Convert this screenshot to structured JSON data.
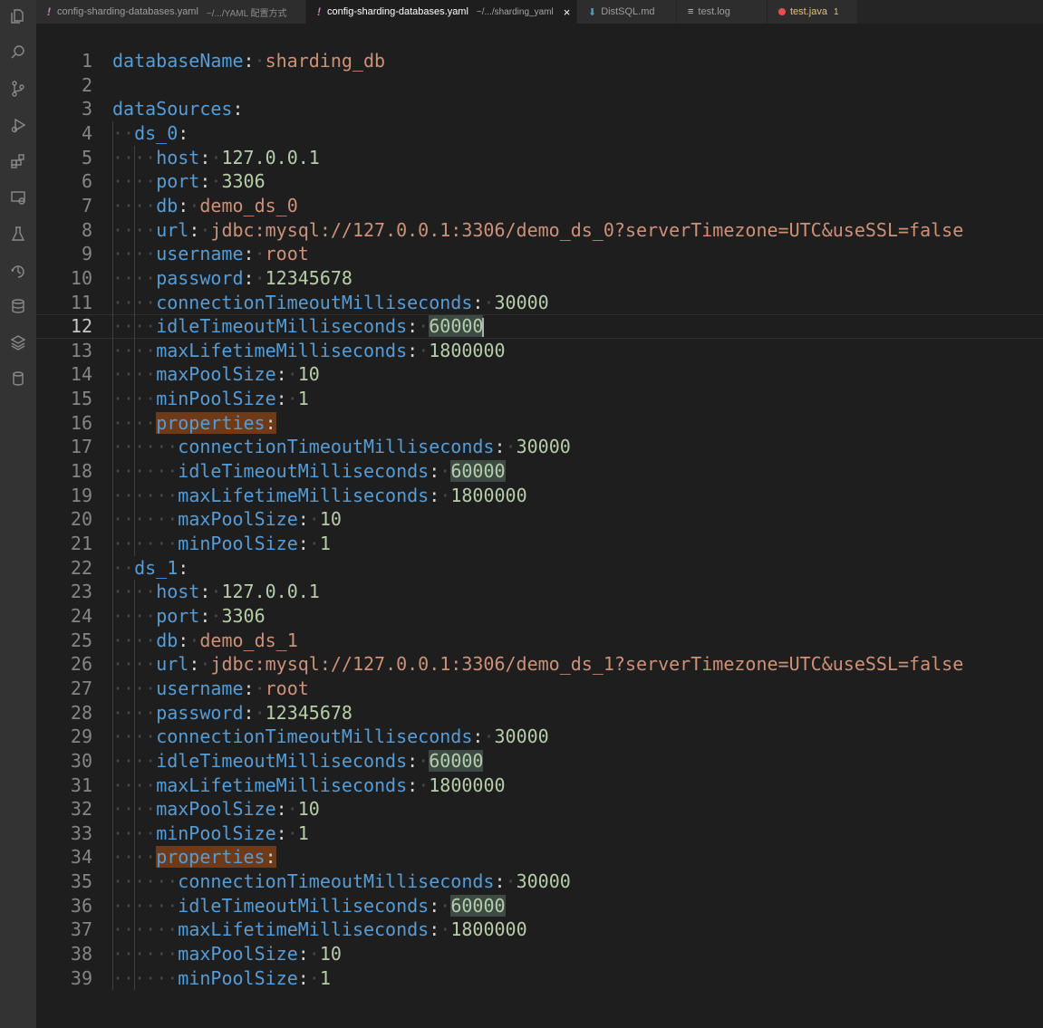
{
  "tabs": [
    {
      "name": "config-sharding-databases.yaml",
      "desc": "~/.../YAML 配置方式",
      "icon": "!",
      "active": false
    },
    {
      "name": "config-sharding-databases.yaml",
      "desc": "~/.../sharding_yaml",
      "icon": "!",
      "active": true,
      "close": "×"
    },
    {
      "name": "DistSQL.md",
      "icon": "⬇",
      "active": false
    },
    {
      "name": "test.log",
      "icon": "≡",
      "active": false
    },
    {
      "name": "test.java",
      "count": "1",
      "active": false
    }
  ],
  "activity_icons": [
    "files-icon",
    "search-icon",
    "source-control-icon",
    "run-debug-icon",
    "extensions-icon",
    "remote-explorer-icon",
    "testing-icon",
    "timeline-icon",
    "database-icon",
    "layers-icon",
    "database-icon-2"
  ],
  "current_line": 12,
  "lines": [
    {
      "n": "1",
      "indent": 0,
      "key": "databaseName",
      "val": "sharding_db",
      "vtype": "s"
    },
    {
      "n": "2",
      "indent": 0
    },
    {
      "n": "3",
      "indent": 0,
      "key": "dataSources"
    },
    {
      "n": "4",
      "indent": 1,
      "key": "ds_0"
    },
    {
      "n": "5",
      "indent": 2,
      "key": "host",
      "val": "127.0.0.1",
      "vtype": "n"
    },
    {
      "n": "6",
      "indent": 2,
      "key": "port",
      "val": "3306",
      "vtype": "n"
    },
    {
      "n": "7",
      "indent": 2,
      "key": "db",
      "val": "demo_ds_0",
      "vtype": "s"
    },
    {
      "n": "8",
      "indent": 2,
      "key": "url",
      "val": "jdbc:mysql://127.0.0.1:3306/demo_ds_0?serverTimezone=UTC&useSSL=false",
      "vtype": "s"
    },
    {
      "n": "9",
      "indent": 2,
      "key": "username",
      "val": "root",
      "vtype": "s"
    },
    {
      "n": "10",
      "indent": 2,
      "key": "password",
      "val": "12345678",
      "vtype": "n"
    },
    {
      "n": "11",
      "indent": 2,
      "key": "connectionTimeoutMilliseconds",
      "val": "30000",
      "vtype": "n"
    },
    {
      "n": "12",
      "indent": 2,
      "key": "idleTimeoutMilliseconds",
      "val": "60000",
      "vtype": "n",
      "hl": true
    },
    {
      "n": "13",
      "indent": 2,
      "key": "maxLifetimeMilliseconds",
      "val": "1800000",
      "vtype": "n"
    },
    {
      "n": "14",
      "indent": 2,
      "key": "maxPoolSize",
      "val": "10",
      "vtype": "n"
    },
    {
      "n": "15",
      "indent": 2,
      "key": "minPoolSize",
      "val": "1",
      "vtype": "n"
    },
    {
      "n": "16",
      "indent": 2,
      "key": "properties",
      "hlk": true
    },
    {
      "n": "17",
      "indent": 3,
      "key": "connectionTimeoutMilliseconds",
      "val": "30000",
      "vtype": "n"
    },
    {
      "n": "18",
      "indent": 3,
      "key": "idleTimeoutMilliseconds",
      "val": "60000",
      "vtype": "n",
      "hl": true
    },
    {
      "n": "19",
      "indent": 3,
      "key": "maxLifetimeMilliseconds",
      "val": "1800000",
      "vtype": "n"
    },
    {
      "n": "20",
      "indent": 3,
      "key": "maxPoolSize",
      "val": "10",
      "vtype": "n"
    },
    {
      "n": "21",
      "indent": 3,
      "key": "minPoolSize",
      "val": "1",
      "vtype": "n"
    },
    {
      "n": "22",
      "indent": 1,
      "key": "ds_1"
    },
    {
      "n": "23",
      "indent": 2,
      "key": "host",
      "val": "127.0.0.1",
      "vtype": "n"
    },
    {
      "n": "24",
      "indent": 2,
      "key": "port",
      "val": "3306",
      "vtype": "n"
    },
    {
      "n": "25",
      "indent": 2,
      "key": "db",
      "val": "demo_ds_1",
      "vtype": "s"
    },
    {
      "n": "26",
      "indent": 2,
      "key": "url",
      "val": "jdbc:mysql://127.0.0.1:3306/demo_ds_1?serverTimezone=UTC&useSSL=false",
      "vtype": "s"
    },
    {
      "n": "27",
      "indent": 2,
      "key": "username",
      "val": "root",
      "vtype": "s"
    },
    {
      "n": "28",
      "indent": 2,
      "key": "password",
      "val": "12345678",
      "vtype": "n"
    },
    {
      "n": "29",
      "indent": 2,
      "key": "connectionTimeoutMilliseconds",
      "val": "30000",
      "vtype": "n"
    },
    {
      "n": "30",
      "indent": 2,
      "key": "idleTimeoutMilliseconds",
      "val": "60000",
      "vtype": "n",
      "hl": true
    },
    {
      "n": "31",
      "indent": 2,
      "key": "maxLifetimeMilliseconds",
      "val": "1800000",
      "vtype": "n"
    },
    {
      "n": "32",
      "indent": 2,
      "key": "maxPoolSize",
      "val": "10",
      "vtype": "n"
    },
    {
      "n": "33",
      "indent": 2,
      "key": "minPoolSize",
      "val": "1",
      "vtype": "n"
    },
    {
      "n": "34",
      "indent": 2,
      "key": "properties",
      "hlk": true
    },
    {
      "n": "35",
      "indent": 3,
      "key": "connectionTimeoutMilliseconds",
      "val": "30000",
      "vtype": "n"
    },
    {
      "n": "36",
      "indent": 3,
      "key": "idleTimeoutMilliseconds",
      "val": "60000",
      "vtype": "n",
      "hl": true
    },
    {
      "n": "37",
      "indent": 3,
      "key": "maxLifetimeMilliseconds",
      "val": "1800000",
      "vtype": "n"
    },
    {
      "n": "38",
      "indent": 3,
      "key": "maxPoolSize",
      "val": "10",
      "vtype": "n"
    },
    {
      "n": "39",
      "indent": 3,
      "key": "minPoolSize",
      "val": "1",
      "vtype": "n"
    }
  ]
}
